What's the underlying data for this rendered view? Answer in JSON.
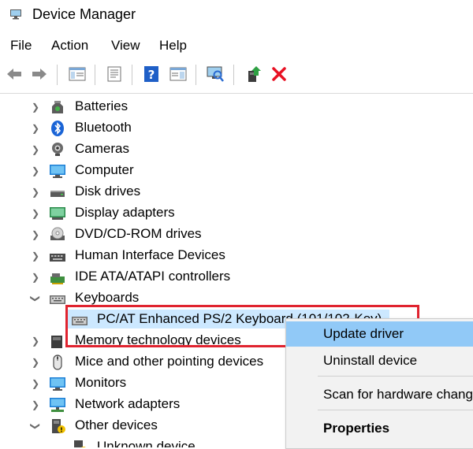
{
  "window": {
    "title": "Device Manager",
    "icon": "device-manager-icon"
  },
  "menu": [
    "File",
    "Action",
    "View",
    "Help"
  ],
  "toolbar": [
    {
      "name": "back-arrow-icon"
    },
    {
      "name": "forward-arrow-icon"
    },
    {
      "name": "show-hide-console-tree-icon"
    },
    {
      "name": "properties-sheet-icon"
    },
    {
      "name": "help-icon"
    },
    {
      "name": "action-pane-icon"
    },
    {
      "name": "scan-hardware-icon"
    },
    {
      "name": "update-driver-icon"
    },
    {
      "name": "uninstall-x-icon"
    }
  ],
  "tree": {
    "items": [
      {
        "label": "Batteries",
        "icon": "battery-icon",
        "expanded": false
      },
      {
        "label": "Bluetooth",
        "icon": "bluetooth-icon",
        "expanded": false
      },
      {
        "label": "Cameras",
        "icon": "camera-icon",
        "expanded": false
      },
      {
        "label": "Computer",
        "icon": "computer-icon",
        "expanded": false
      },
      {
        "label": "Disk drives",
        "icon": "disk-drive-icon",
        "expanded": false
      },
      {
        "label": "Display adapters",
        "icon": "display-adapter-icon",
        "expanded": false
      },
      {
        "label": "DVD/CD-ROM drives",
        "icon": "dvd-drive-icon",
        "expanded": false
      },
      {
        "label": "Human Interface Devices",
        "icon": "hid-icon",
        "expanded": false
      },
      {
        "label": "IDE ATA/ATAPI controllers",
        "icon": "ide-controller-icon",
        "expanded": false
      },
      {
        "label": "Keyboards",
        "icon": "keyboard-icon",
        "expanded": true
      },
      {
        "label": "PC/AT Enhanced PS/2 Keyboard (101/102-Key)",
        "icon": "keyboard-icon",
        "child": true,
        "selected": true
      },
      {
        "label": "Memory technology devices",
        "icon": "memory-device-icon",
        "expanded": false
      },
      {
        "label": "Mice and other pointing devices",
        "icon": "mouse-icon",
        "expanded": false
      },
      {
        "label": "Monitors",
        "icon": "monitor-icon",
        "expanded": false
      },
      {
        "label": "Network adapters",
        "icon": "network-adapter-icon",
        "expanded": false
      },
      {
        "label": "Other devices",
        "icon": "other-devices-icon",
        "expanded": true
      },
      {
        "label": "Unknown device",
        "icon": "unknown-device-icon",
        "child": true
      }
    ]
  },
  "context_menu": {
    "items": [
      {
        "label": "Update driver",
        "highlighted": true
      },
      {
        "label": "Uninstall device"
      },
      {
        "label": "Scan for hardware changes"
      },
      {
        "label": "Properties",
        "bold": true
      }
    ]
  },
  "colors": {
    "selection": "#cce8ff",
    "menu_highlight": "#91c9f7",
    "annotation_red": "#e0232f",
    "uninstall_red": "#e81123"
  }
}
